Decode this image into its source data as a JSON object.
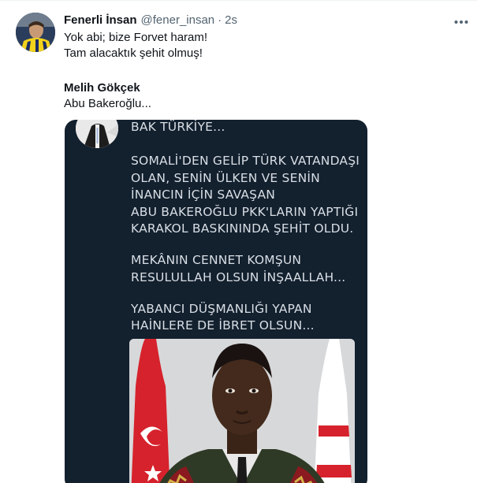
{
  "tweet": {
    "display_name": "Fenerli İnsan",
    "handle": "@fener_insan",
    "separator": "·",
    "time": "2s",
    "lines": [
      "Yok abi; bize Forvet haram!",
      "Tam alacaktık şehit olmuş!"
    ],
    "quoted_name": "Melih Gökçek",
    "quoted_text": "Abu Bakeroğlu..."
  },
  "icons": {
    "more": "more-horizontal-icon",
    "avatar": "user-avatar",
    "card_avatar": "card-avatar"
  },
  "media": {
    "lines": [
      "BAK TÜRKİYE...",
      "SOMALİ'DEN GELİP TÜRK VATANDAŞI",
      "OLAN, SENİN ÜLKEN VE SENİN",
      "İNANCIN İÇİN SAVAŞAN",
      "ABU BAKEROĞLU PKK'LARIN YAPTIĞI",
      "KARAKOL BASKININDA ŞEHİT OLDU.",
      "MEKÂNIN CENNET KOMŞUN",
      "RESULULLAH OLSUN İNŞAALLAH...",
      "YABANCI DÜŞMANLIĞI YAPAN",
      "HAİNLERE DE İBRET OLSUN..."
    ]
  },
  "colors": {
    "text_primary": "#0f1419",
    "text_secondary": "#536471",
    "card_background": "#13202e",
    "card_text": "#d8dee5",
    "flag_red": "#d6222c"
  }
}
